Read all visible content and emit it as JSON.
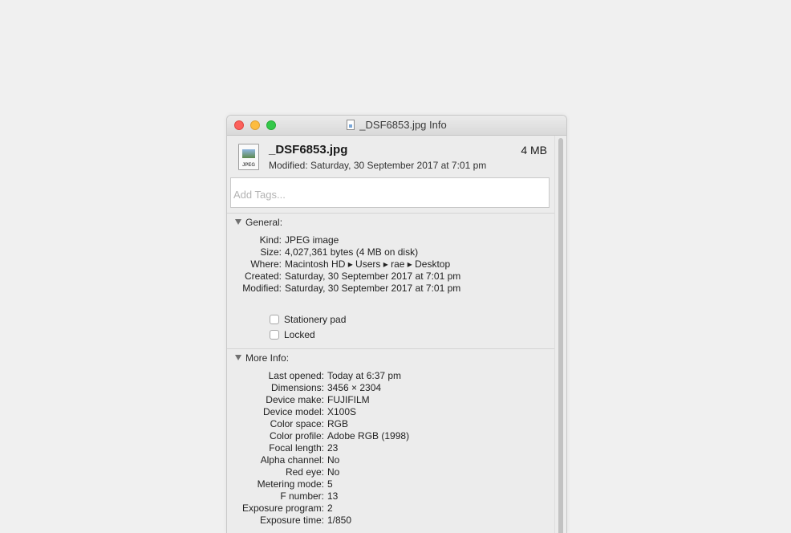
{
  "window": {
    "title": "_DSF6853.jpg Info"
  },
  "header": {
    "icon_label": "JPEG",
    "file_name": "_DSF6853.jpg",
    "file_size": "4 MB",
    "modified": "Modified: Saturday, 30 September 2017 at 7:01 pm"
  },
  "tags": {
    "placeholder": "Add Tags..."
  },
  "general": {
    "title": "General:",
    "rows": [
      {
        "key": "Kind:",
        "value": "JPEG image"
      },
      {
        "key": "Size:",
        "value": "4,027,361 bytes (4 MB on disk)"
      },
      {
        "key": "Where:",
        "value": "Macintosh HD ▸ Users ▸ rae ▸ Desktop"
      },
      {
        "key": "Created:",
        "value": "Saturday, 30 September 2017 at 7:01 pm"
      },
      {
        "key": "Modified:",
        "value": "Saturday, 30 September 2017 at 7:01 pm"
      }
    ],
    "stationery_label": "Stationery pad",
    "locked_label": "Locked"
  },
  "more_info": {
    "title": "More Info:",
    "rows": [
      {
        "key": "Last opened:",
        "value": "Today at 6:37 pm"
      },
      {
        "key": "Dimensions:",
        "value": "3456 × 2304"
      },
      {
        "key": "Device make:",
        "value": "FUJIFILM"
      },
      {
        "key": "Device model:",
        "value": "X100S"
      },
      {
        "key": "Color space:",
        "value": "RGB"
      },
      {
        "key": "Color profile:",
        "value": "Adobe RGB (1998)"
      },
      {
        "key": "Focal length:",
        "value": "23"
      },
      {
        "key": "Alpha channel:",
        "value": "No"
      },
      {
        "key": "Red eye:",
        "value": "No"
      },
      {
        "key": "Metering mode:",
        "value": "5"
      },
      {
        "key": "F number:",
        "value": "13"
      },
      {
        "key": "Exposure program:",
        "value": "2"
      },
      {
        "key": "Exposure time:",
        "value": "1/850"
      }
    ]
  },
  "colors": {
    "close": "#fc605b",
    "minimize": "#fdbc40",
    "maximize": "#34c84a",
    "window_bg": "#ececec",
    "page_bg": "#f0f0f0"
  },
  "icons": {
    "window": [
      "close-icon",
      "minimize-icon",
      "maximize-icon",
      "document-icon"
    ],
    "file": "jpeg-file-icon",
    "disclosure": "disclosure-triangle-icon"
  }
}
